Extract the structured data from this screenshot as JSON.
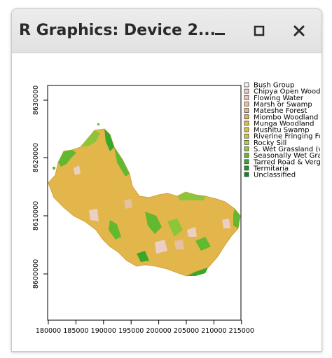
{
  "window": {
    "title": "R Graphics: Device 2...",
    "buttons": {
      "minimize": "minimize",
      "maximize": "maximize",
      "close": "close"
    }
  },
  "plot": {
    "x_ticks": [
      "180000",
      "185000",
      "190000",
      "195000",
      "200000",
      "205000",
      "210000",
      "215000"
    ],
    "y_ticks": [
      "8600000",
      "8610000",
      "8620000",
      "8630000"
    ],
    "legend": [
      {
        "label": "Bush Group",
        "color": "#f2f2f2"
      },
      {
        "label": "Chipya Open Woodl",
        "color": "#ebcfc3"
      },
      {
        "label": "Flowing Water",
        "color": "#e8c7b9"
      },
      {
        "label": "Marsh or Swamp",
        "color": "#e6c0a0"
      },
      {
        "label": "Mateshe Forest",
        "color": "#e3b67c"
      },
      {
        "label": "Miombo Woodland",
        "color": "#e3b64b"
      },
      {
        "label": "Munga Woodland",
        "color": "#e0bc3c"
      },
      {
        "label": "Mushitu Swamp",
        "color": "#d8c234"
      },
      {
        "label": "Riverine Fringing Fo",
        "color": "#c8c83a"
      },
      {
        "label": "Rocky Sill",
        "color": "#b4ce42"
      },
      {
        "label": "S. Wet Grassland (v",
        "color": "#8cc43a"
      },
      {
        "label": "Seasonally Wet Gra",
        "color": "#62b82e"
      },
      {
        "label": "Tarred Road & Verg",
        "color": "#3aa62a"
      },
      {
        "label": "Termitaria",
        "color": "#1d9624"
      },
      {
        "label": "Unclassified",
        "color": "#0d8a1e"
      }
    ]
  }
}
